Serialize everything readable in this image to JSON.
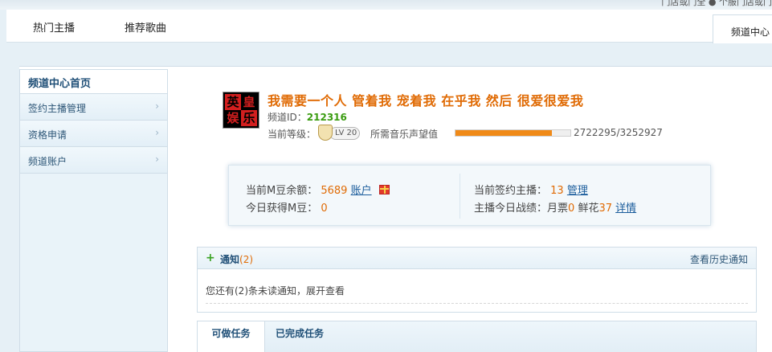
{
  "top_strip": {
    "clipped_text": "门店或门全 ● 个服门店或门"
  },
  "nav": {
    "items": [
      "热门主播",
      "推荐歌曲"
    ],
    "right_tab": "频道中心"
  },
  "sidebar": {
    "title": "频道中心首页",
    "items": [
      {
        "label": "签约主播管理"
      },
      {
        "label": "资格申请"
      },
      {
        "label": "频道账户"
      }
    ],
    "chevron": "›"
  },
  "channel": {
    "avatar_chars": [
      "英",
      "皇",
      "娱",
      "乐"
    ],
    "title": "我需要一个人 管着我 宠着我 在乎我 然后 很爱很爱我",
    "id_label": "频道ID：",
    "id_value": "212316",
    "level_label": "当前等级：",
    "level_badge": "LV 20",
    "need_label": "所需音乐声望值",
    "progress_text": "2722295/3252927",
    "progress_fraction": 0.837
  },
  "stats": {
    "balance_label": "当前M豆余额：",
    "balance_value": "5689",
    "balance_link": "账户",
    "today_label": "今日获得M豆：",
    "today_value": "0",
    "anchors_label": "当前签约主播：",
    "anchors_value": "13",
    "anchors_link": "管理",
    "record_label": "主播今日战绩：",
    "ticket_label": "月票",
    "ticket_value": "0",
    "flower_label": "鲜花",
    "flower_value": "37",
    "detail_link": "详情"
  },
  "notice": {
    "title": "通知",
    "count": "(2)",
    "history_link": "查看历史通知",
    "body": "您还有(2)条未读通知，展开查看"
  },
  "tasks": {
    "tabs": [
      "可做任务",
      "已完成任务"
    ]
  },
  "colors": {
    "accent_orange": "#e06b05",
    "link_blue": "#1b5d9c",
    "id_green": "#3a9c10",
    "progress": "#f08a18"
  }
}
